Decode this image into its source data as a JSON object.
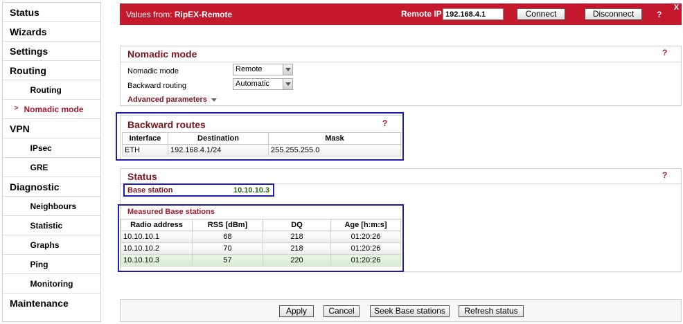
{
  "sidebar": {
    "items": [
      {
        "label": "Status"
      },
      {
        "label": "Wizards"
      },
      {
        "label": "Settings"
      },
      {
        "label": "Routing"
      },
      {
        "label": "Routing"
      },
      {
        "label": "Nomadic mode",
        "arrow": ">"
      },
      {
        "label": "VPN"
      },
      {
        "label": "IPsec"
      },
      {
        "label": "GRE"
      },
      {
        "label": "Diagnostic"
      },
      {
        "label": "Neighbours"
      },
      {
        "label": "Statistic"
      },
      {
        "label": "Graphs"
      },
      {
        "label": "Ping"
      },
      {
        "label": "Monitoring"
      },
      {
        "label": "Maintenance"
      }
    ]
  },
  "topbar": {
    "title_prefix": "Values from: ",
    "device": "RipEX-Remote",
    "remote_ip_label": "Remote IP",
    "remote_ip_value": "192.168.4.1",
    "connect": "Connect",
    "disconnect": "Disconnect",
    "help": "?",
    "close": "X"
  },
  "nomadic": {
    "title": "Nomadic mode",
    "help": "?",
    "mode_label": "Nomadic mode",
    "mode_value": "Remote",
    "backward_label": "Backward routing",
    "backward_value": "Automatic",
    "advanced": "Advanced parameters"
  },
  "backward_routes": {
    "title": "Backward routes",
    "help": "?",
    "headers": [
      "Interface",
      "Destination",
      "Mask"
    ],
    "rows": [
      [
        "ETH",
        "192.168.4.1/24",
        "255.255.255.0"
      ]
    ]
  },
  "status": {
    "title": "Status",
    "help": "?",
    "base_station_label": "Base station",
    "base_station_value": "10.10.10.3",
    "measured_title": "Measured Base stations",
    "headers": [
      "Radio address",
      "RSS [dBm]",
      "DQ",
      "Age [h:m:s]"
    ],
    "rows": [
      [
        "10.10.10.1",
        "68",
        "218",
        "01:20:26"
      ],
      [
        "10.10.10.2",
        "70",
        "218",
        "01:20:26"
      ],
      [
        "10.10.10.3",
        "57",
        "220",
        "01:20:26"
      ]
    ]
  },
  "footer": {
    "apply": "Apply",
    "cancel": "Cancel",
    "seek": "Seek Base stations",
    "refresh": "Refresh status"
  },
  "colors": {
    "brand_red": "#c4182c",
    "title_maroon": "#7a1420",
    "highlight_blue": "#1c1cb8",
    "value_green": "#2d6a14"
  }
}
